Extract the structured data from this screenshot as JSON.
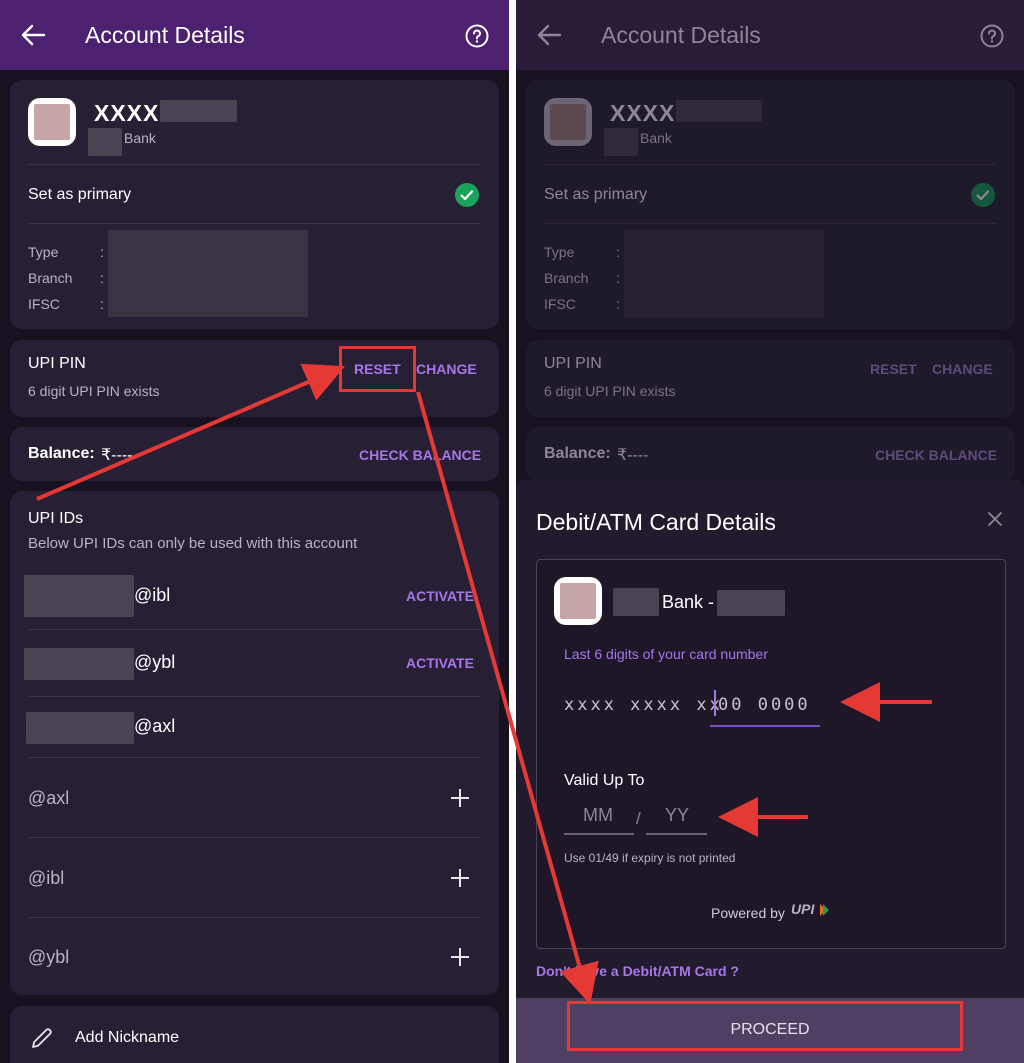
{
  "left": {
    "header": {
      "title": "Account Details"
    },
    "account": {
      "masked_number": "XXXX",
      "bank_suffix": "Bank",
      "primary_label": "Set as primary"
    },
    "details": [
      {
        "label": "Type",
        "sep": ":"
      },
      {
        "label": "Branch",
        "sep": ":"
      },
      {
        "label": "IFSC",
        "sep": ":"
      }
    ],
    "upi_pin": {
      "title": "UPI PIN",
      "subtitle": "6 digit UPI PIN exists",
      "reset": "RESET",
      "change": "CHANGE"
    },
    "balance": {
      "label": "Balance:",
      "value": "₹----",
      "action": "CHECK BALANCE"
    },
    "upi_ids": {
      "title": "UPI IDs",
      "subtitle": "Below UPI IDs can only be used with this account",
      "existing": [
        {
          "handle": "@ibl",
          "action": "ACTIVATE"
        },
        {
          "handle": "@ybl",
          "action": "ACTIVATE"
        },
        {
          "handle": "@axl",
          "action": ""
        }
      ],
      "add": [
        {
          "handle": "@axl"
        },
        {
          "handle": "@ibl"
        },
        {
          "handle": "@ybl"
        }
      ]
    },
    "nickname": {
      "label": "Add Nickname"
    }
  },
  "right": {
    "header": {
      "title": "Account Details"
    },
    "account": {
      "masked_number": "XXXX",
      "bank_suffix": "Bank",
      "primary_label": "Set as primary"
    },
    "details": [
      {
        "label": "Type",
        "sep": ":"
      },
      {
        "label": "Branch",
        "sep": ":"
      },
      {
        "label": "IFSC",
        "sep": ":"
      }
    ],
    "upi_pin": {
      "title": "UPI PIN",
      "subtitle": "6 digit UPI PIN exists",
      "reset": "RESET",
      "change": "CHANGE"
    },
    "balance": {
      "label": "Balance:",
      "value": "₹----",
      "action": "CHECK BALANCE"
    },
    "sheet": {
      "title": "Debit/ATM Card Details",
      "bank_name": "Bank -",
      "card_label": "Last 6 digits of your card number",
      "card_prefix": "xxxx xxxx xx",
      "card_value": "00 0000",
      "valid_label": "Valid Up To",
      "month_placeholder": "MM",
      "slash": "/",
      "year_placeholder": "YY",
      "hint": "Use 01/49 if expiry is not printed",
      "powered_by": "Powered by",
      "upi_logo": "UPI",
      "no_card_link": "Don't have a Debit/ATM Card ?",
      "proceed": "PROCEED"
    }
  },
  "colors": {
    "header": "#4b2170",
    "accent": "#a776e8",
    "background": "#181120",
    "card": "#272034",
    "annotation": "#e53935",
    "success": "#1aa35a"
  },
  "icons": [
    "back-arrow-icon",
    "help-icon",
    "check-circle-icon",
    "plus-icon",
    "pencil-icon",
    "close-icon",
    "upi-logo-icon"
  ]
}
